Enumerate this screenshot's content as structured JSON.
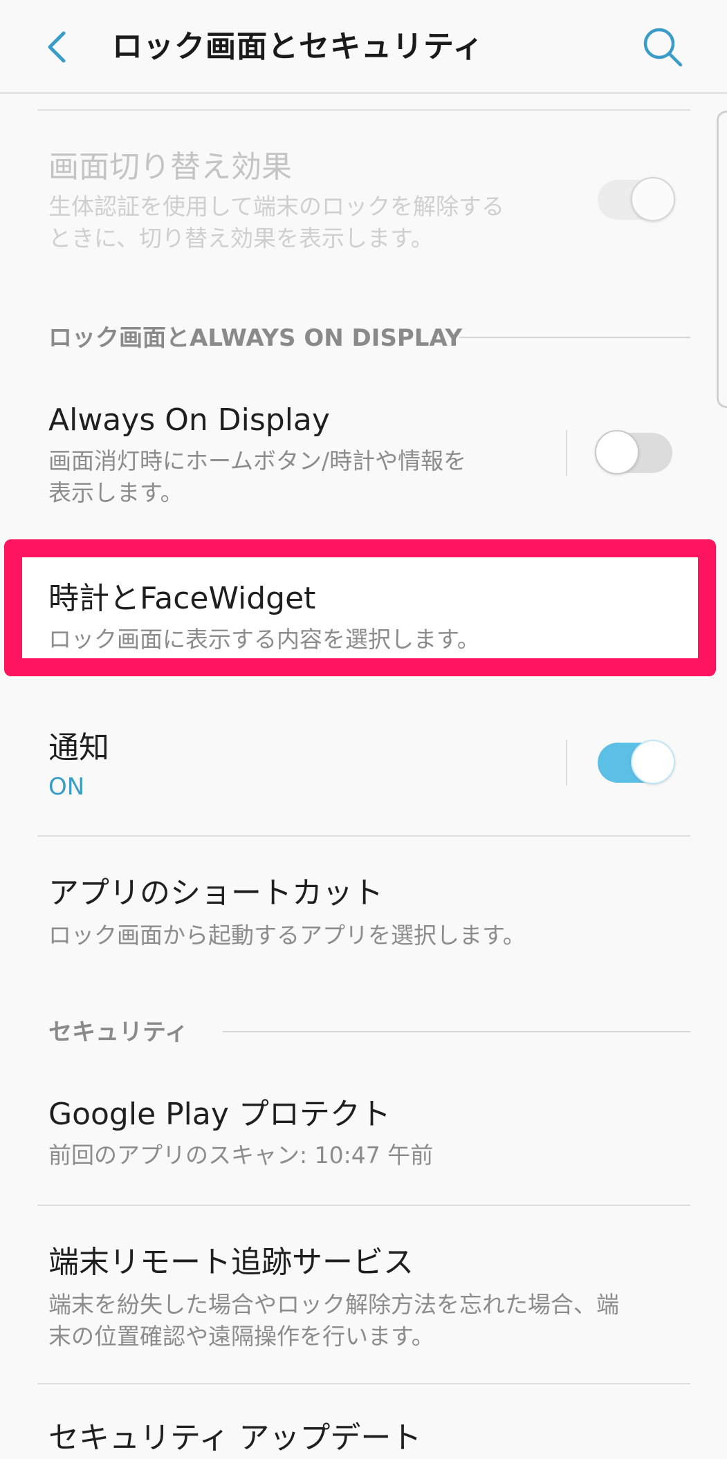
{
  "header": {
    "title": "ロック画面とセキュリティ",
    "back_icon": "chevron-left-icon",
    "search_icon": "search-icon",
    "accent": "#3a9cc8"
  },
  "rows": {
    "transition": {
      "title": "画面切り替え効果",
      "subtitle_line1": "生体認証を使用して端末のロックを解除する",
      "subtitle_line2": "ときに、切り替え効果を表示します。",
      "toggle_state": "on",
      "enabled": false
    },
    "aod_section": {
      "label": "ロック画面とALWAYS ON DISPLAY"
    },
    "aod": {
      "title": "Always On Display",
      "subtitle_line1": "画面消灯時にホームボタン/時計や情報を",
      "subtitle_line2": "表示します。",
      "toggle_state": "off"
    },
    "clock": {
      "title": "時計とFaceWidget",
      "subtitle": "ロック画面に表示する内容を選択します。",
      "highlight_color": "#ff1460"
    },
    "notifications": {
      "title": "通知",
      "status": "ON",
      "toggle_state": "on",
      "toggle_color": "#5cbfe6"
    },
    "app_shortcuts": {
      "title": "アプリのショートカット",
      "subtitle": "ロック画面から起動するアプリを選択します。"
    },
    "security_section": {
      "label": "セキュリティ"
    },
    "play_protect": {
      "title": "Google Play プロテクト",
      "subtitle": "前回のアプリのスキャン: 10:47 午前"
    },
    "find_device": {
      "title": "端末リモート追跡サービス",
      "subtitle_line1": "端末を紛失した場合やロック解除方法を忘れた場合、端",
      "subtitle_line2": "末の位置確認や遠隔操作を行います。"
    },
    "security_update": {
      "title": "セキュリティ アップデート"
    }
  }
}
